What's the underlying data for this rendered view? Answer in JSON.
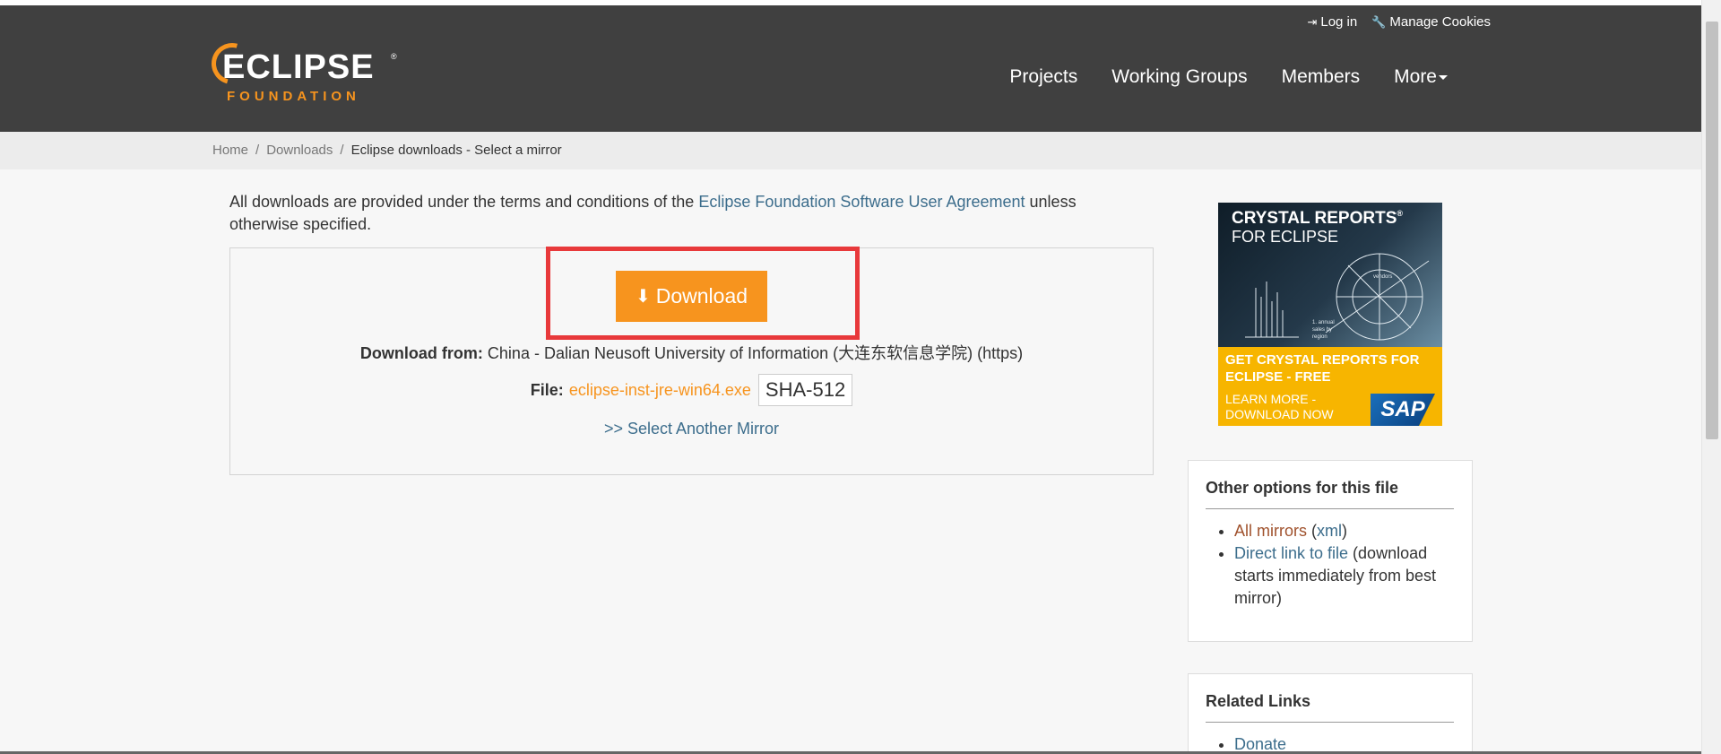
{
  "header": {
    "utility": {
      "login_label": "Log in",
      "cookies_label": "Manage Cookies"
    },
    "logo": {
      "word": "ECLIPSE",
      "sub": "FOUNDATION",
      "reg": "®"
    },
    "nav": {
      "projects": "Projects",
      "working_groups": "Working Groups",
      "members": "Members",
      "more": "More"
    }
  },
  "breadcrumb": {
    "home": "Home",
    "downloads": "Downloads",
    "current": "Eclipse downloads - Select a mirror",
    "separator": "/"
  },
  "terms": {
    "prefix": "All downloads are provided under the terms and conditions of the ",
    "link": "Eclipse Foundation Software User Agreement",
    "suffix": " unless otherwise specified."
  },
  "download": {
    "button_label": "Download",
    "from_label": "Download from:",
    "from_value": "China - Dalian Neusoft University of Information (大连东软信息学院) (https)",
    "file_label": "File:",
    "file_name": "eclipse-inst-jre-win64.exe",
    "sha_label": "SHA-512",
    "mirror_link": ">> Select Another Mirror"
  },
  "ad": {
    "title": "CRYSTAL REPORTS",
    "title_reg": "®",
    "sub": "FOR ECLIPSE",
    "cta_line1": "GET CRYSTAL REPORTS FOR",
    "cta_line2": "ECLIPSE - FREE",
    "learn_line1": "LEARN MORE -",
    "learn_line2": "DOWNLOAD NOW",
    "brand": "SAP",
    "graphic_text1": "1. annual",
    "graphic_text2": "sales by",
    "graphic_text3": "region",
    "graphic_text4": "vendors"
  },
  "options_panel": {
    "title": "Other options for this file",
    "all_mirrors": "All mirrors",
    "xml_open": " (",
    "xml": "xml",
    "xml_close": ")",
    "direct_link": "Direct link to file",
    "direct_desc": " (download starts immediately from best mirror)"
  },
  "related_panel": {
    "title": "Related Links",
    "donate": "Donate"
  },
  "icons": {
    "login": "sign-in-icon",
    "cookies": "wrench-icon",
    "download": "download-icon",
    "caret": "caret-down-icon"
  },
  "colors": {
    "header_bg": "#404040",
    "accent_orange": "#f7941e",
    "link_blue": "#3c6d8c",
    "highlight_red": "#e8393b"
  }
}
